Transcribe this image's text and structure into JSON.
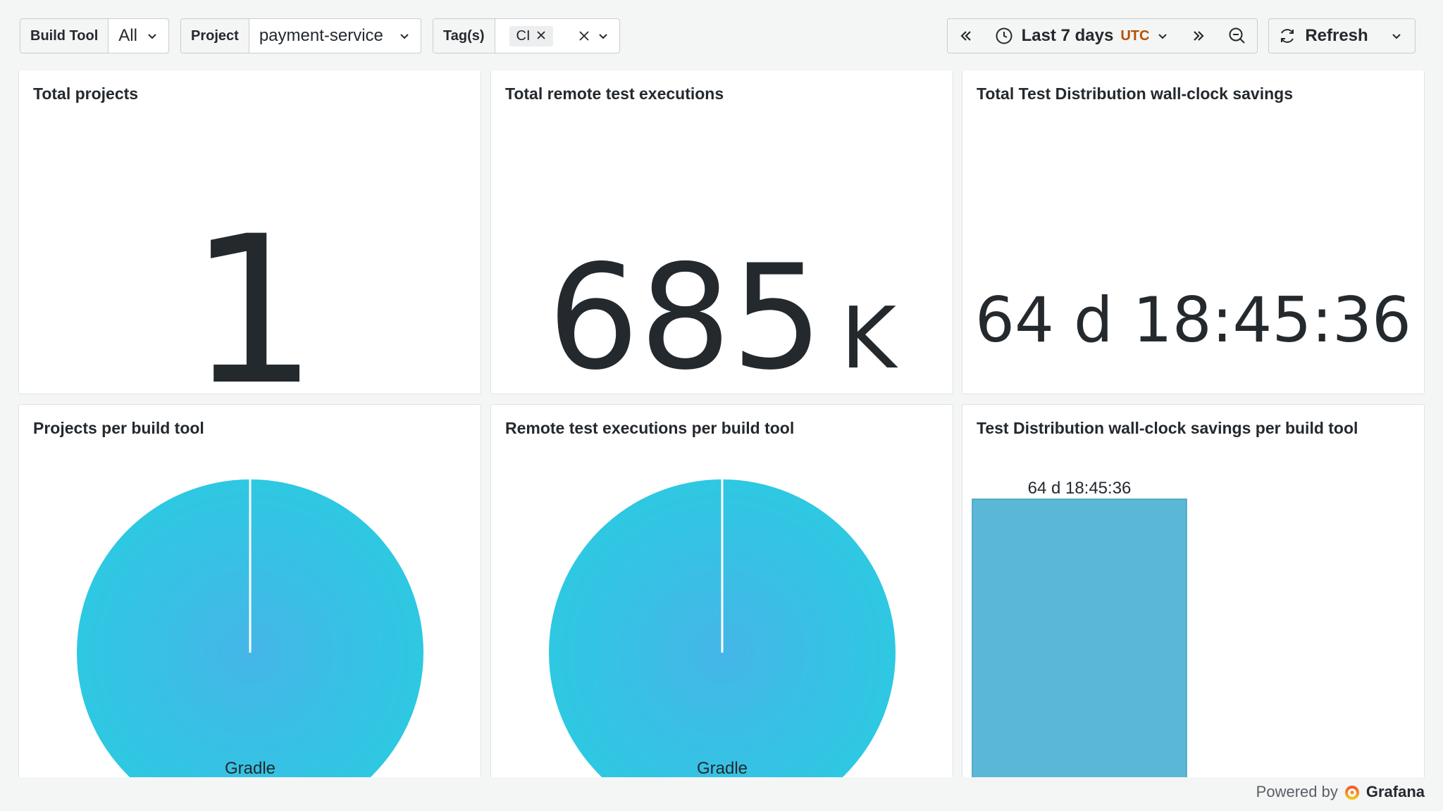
{
  "filters": {
    "build_tool": {
      "label": "Build Tool",
      "value": "All"
    },
    "project": {
      "label": "Project",
      "value": "payment-service"
    },
    "tags": {
      "label": "Tag(s)",
      "chip": "CI"
    }
  },
  "time": {
    "range": "Last 7 days",
    "timezone": "UTC"
  },
  "actions": {
    "refresh": "Refresh"
  },
  "panels": {
    "total_projects": {
      "title": "Total projects",
      "value": "1"
    },
    "total_remote_tests": {
      "title": "Total remote test executions",
      "value": "685",
      "unit": "K"
    },
    "total_savings": {
      "title": "Total Test Distribution wall-clock savings",
      "value": "64 d 18:45:36"
    },
    "projects_per_tool": {
      "title": "Projects per build tool"
    },
    "tests_per_tool": {
      "title": "Remote test executions per build tool"
    },
    "savings_per_tool": {
      "title": "Test Distribution wall-clock savings per build tool"
    }
  },
  "footer": {
    "powered": "Powered by",
    "brand": "Grafana"
  },
  "colors": {
    "pie": "#2ec8e2",
    "bar": "#5ab8d6",
    "timezone": "#b84f00"
  },
  "icons": [
    "chevron-down-icon",
    "close-icon",
    "clock-icon",
    "chevron-double-left-icon",
    "chevron-double-right-icon",
    "zoom-out-icon",
    "refresh-icon"
  ],
  "chart_data": [
    {
      "type": "pie",
      "categories": [
        "Gradle"
      ],
      "values": [
        1
      ]
    },
    {
      "type": "pie",
      "categories": [
        "Gradle"
      ],
      "values": [
        685000
      ]
    },
    {
      "type": "bar",
      "categories": [
        "Gradle"
      ],
      "values": [
        5589936
      ],
      "data_labels": [
        "64 d 18:45:36"
      ]
    }
  ]
}
